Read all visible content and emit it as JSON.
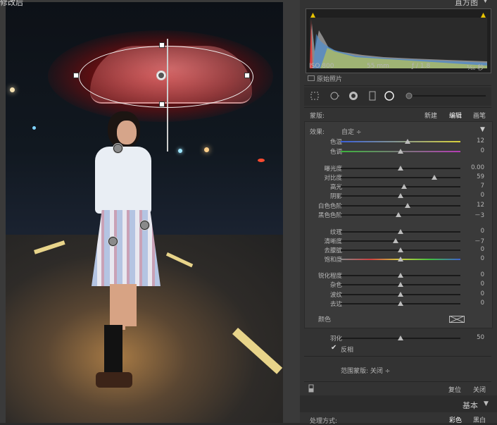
{
  "photo": {
    "label": "修改后"
  },
  "histogram": {
    "title": "直方图",
    "iso": "ISO 800",
    "focal": "55 mm",
    "aperture": "ƒ / 1.8",
    "shutter": "¹⁄₆₀ 秒",
    "original_photo_label": "原始照片"
  },
  "mask": {
    "label": "蒙版:",
    "new_label": "新建",
    "edit_label": "编辑",
    "brush_label": "画笔"
  },
  "effect": {
    "label": "效果:",
    "value": "自定 ÷"
  },
  "sliders": [
    {
      "label": "色温",
      "value": "12",
      "fraction": 0.56,
      "gradient": "linear-gradient(90deg,#3a5fd9,#d8d23a)"
    },
    {
      "label": "色调",
      "value": "0",
      "fraction": 0.5,
      "gradient": "linear-gradient(90deg,#3cb43c,#b43cb4)"
    },
    {
      "label": "曝光度",
      "value": "0.00",
      "fraction": 0.5
    },
    {
      "label": "对比度",
      "value": "59",
      "fraction": 0.78
    },
    {
      "label": "高光",
      "value": "7",
      "fraction": 0.53
    },
    {
      "label": "阴影",
      "value": "0",
      "fraction": 0.5
    },
    {
      "label": "白色色阶",
      "value": "12",
      "fraction": 0.56
    },
    {
      "label": "黑色色阶",
      "value": "－3",
      "fraction": 0.48
    },
    {
      "label": "纹理",
      "value": "0",
      "fraction": 0.5
    },
    {
      "label": "清晰度",
      "value": "－7",
      "fraction": 0.46
    },
    {
      "label": "去朦胧",
      "value": "0",
      "fraction": 0.5
    },
    {
      "label": "饱和度",
      "value": "0",
      "fraction": 0.5,
      "gradient": "linear-gradient(90deg,#888,#d04040,#d0d040,#40c040,#4060d0)"
    },
    {
      "label": "锐化程度",
      "value": "0",
      "fraction": 0.5
    },
    {
      "label": "杂色",
      "value": "0",
      "fraction": 0.5
    },
    {
      "label": "波纹",
      "value": "0",
      "fraction": 0.5
    },
    {
      "label": "去边",
      "value": "0",
      "fraction": 0.5
    }
  ],
  "color": {
    "label": "颜色"
  },
  "feather": {
    "label": "羽化",
    "value": "50",
    "fraction": 0.5
  },
  "invert": {
    "label": "反相",
    "checked": "✔"
  },
  "range_mask": {
    "label": "范围蒙版: 关闭 ÷"
  },
  "footer": {
    "reset_label": "复位",
    "close_label": "关闭"
  },
  "basic": {
    "title": "基本",
    "treatment_label": "处理方式:",
    "color_label": "彩色",
    "bw_label": "黑白"
  },
  "colors": {
    "panel": "#333333",
    "accent": "#e6c200"
  }
}
